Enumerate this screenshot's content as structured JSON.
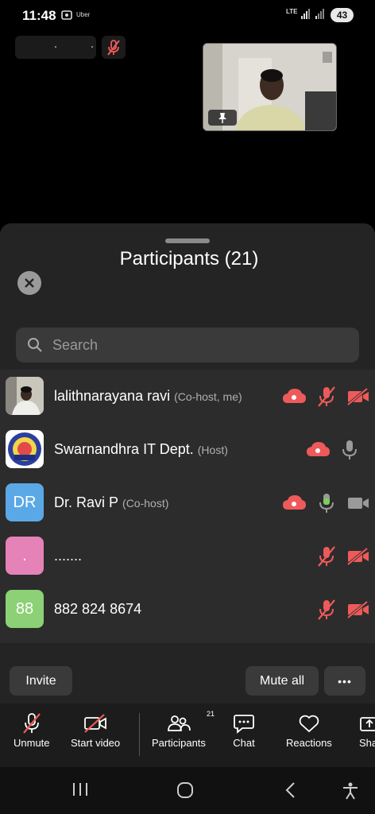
{
  "status_bar": {
    "time": "11:48",
    "app_icon": "uber-icon",
    "app_label": "Uber",
    "network": "LTE",
    "battery": "43"
  },
  "meeting": {
    "self_video_icon": "pin-icon"
  },
  "participants_panel": {
    "title": "Participants (21)",
    "search_placeholder": "Search",
    "participants": [
      {
        "name": "lalithnarayana ravi",
        "role": "(Co-host, me)",
        "avatar": "photo",
        "cloud": true,
        "mic": "muted",
        "video": "off"
      },
      {
        "name": "Swarnandhra IT Dept.",
        "role": "(Host)",
        "avatar": "logo",
        "cloud": true,
        "mic": "on",
        "video": "none"
      },
      {
        "name": "Dr. Ravi P",
        "role": "(Co-host)",
        "avatar_initials": "DR",
        "avatar_color": "#5aa9e6",
        "cloud": true,
        "mic": "speaking",
        "video": "on"
      },
      {
        "name": ".......",
        "role": "",
        "avatar_initials": ".",
        "avatar_color": "#e582b8",
        "cloud": false,
        "mic": "muted",
        "video": "off"
      },
      {
        "name": "882 824 8674",
        "role": "",
        "avatar_initials": "88",
        "avatar_color": "#8cd175",
        "cloud": false,
        "mic": "muted",
        "video": "off"
      }
    ],
    "invite_label": "Invite",
    "mute_all_label": "Mute all",
    "more_label": "•••"
  },
  "toolbar": {
    "unmute": "Unmute",
    "start_video": "Start video",
    "participants": "Participants",
    "participants_count": "21",
    "chat": "Chat",
    "reactions": "Reactions",
    "share": "Share"
  },
  "colors": {
    "accent_red": "#ee5a5a",
    "mic_green": "#7ccf5b",
    "panel_bg": "#242424",
    "list_bg": "#2c2c2c"
  }
}
